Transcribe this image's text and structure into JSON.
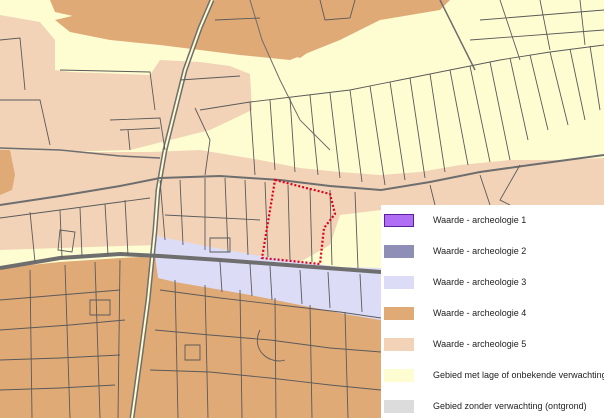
{
  "legend": {
    "items": [
      {
        "label": "Waarde - archeologie 1",
        "color": "#b06ef5",
        "border": "#5a1f99"
      },
      {
        "label": "Waarde - archeologie 2",
        "color": "#8e8eb6",
        "border": "#8e8eb6"
      },
      {
        "label": "Waarde - archeologie 3",
        "color": "#dcdcf6",
        "border": "#dcdcf6"
      },
      {
        "label": "Waarde - archeologie 4",
        "color": "#e0aa77",
        "border": "#e0aa77"
      },
      {
        "label": "Waarde - archeologie 5",
        "color": "#f2d3b8",
        "border": "#f2d3b8"
      },
      {
        "label": "Gebied met lage of onbekende verwachting",
        "color": "#fefdd1",
        "border": "#fefdd1"
      },
      {
        "label": "Gebied zonder verwachting (ontgrond)",
        "color": "#dcdcdc",
        "border": "#dcdcdc"
      }
    ]
  },
  "colors": {
    "base": "#fefdd1",
    "value4": "#e0aa77",
    "value5": "#f2d3b8",
    "value3": "#dcdcf6",
    "parcel_lines": "#5a5a5a",
    "roads": "#6e6e6e",
    "plan_boundary": "#e0001b"
  }
}
